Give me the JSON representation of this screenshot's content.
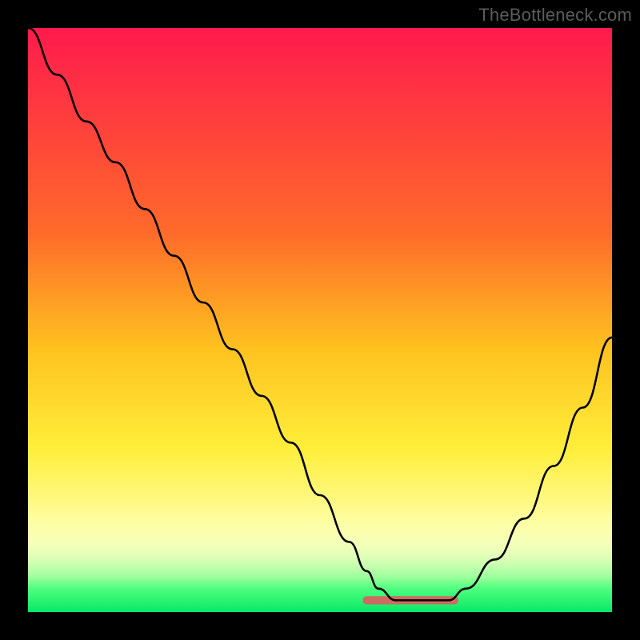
{
  "attribution": "TheBottleneck.com",
  "colors": {
    "frame": "#000000",
    "curve": "#000000",
    "highlight": "#cf6a60",
    "gradient_stops": [
      {
        "offset": 0,
        "color": "#ff1a4d"
      },
      {
        "offset": 35,
        "color": "#ff6a2a"
      },
      {
        "offset": 55,
        "color": "#ffc21f"
      },
      {
        "offset": 72,
        "color": "#ffee3a"
      },
      {
        "offset": 80,
        "color": "#fff77a"
      },
      {
        "offset": 85,
        "color": "#fdffa6"
      },
      {
        "offset": 88,
        "color": "#f5ffb8"
      },
      {
        "offset": 90,
        "color": "#e6ffb8"
      },
      {
        "offset": 92,
        "color": "#c9ffb0"
      },
      {
        "offset": 94,
        "color": "#9cff9c"
      },
      {
        "offset": 96,
        "color": "#4eff7e"
      },
      {
        "offset": 100,
        "color": "#08e867"
      }
    ]
  },
  "chart_data": {
    "type": "line",
    "title": "",
    "xlabel": "",
    "ylabel": "",
    "xlim": [
      0,
      100
    ],
    "ylim": [
      0,
      100
    ],
    "series": [
      {
        "name": "curve",
        "x": [
          0,
          5,
          10,
          15,
          20,
          25,
          30,
          35,
          40,
          45,
          50,
          55,
          58,
          60,
          63,
          68,
          70,
          72,
          75,
          80,
          85,
          90,
          95,
          100
        ],
        "values": [
          100,
          92,
          84,
          77,
          69,
          61,
          53,
          45,
          37,
          29,
          20,
          12,
          7,
          4,
          2,
          2,
          2,
          2,
          4,
          9,
          16,
          25,
          35,
          47
        ]
      }
    ],
    "highlight_band": {
      "x_start": 58,
      "x_end": 73,
      "y": 2
    },
    "legend": null,
    "grid": false
  }
}
